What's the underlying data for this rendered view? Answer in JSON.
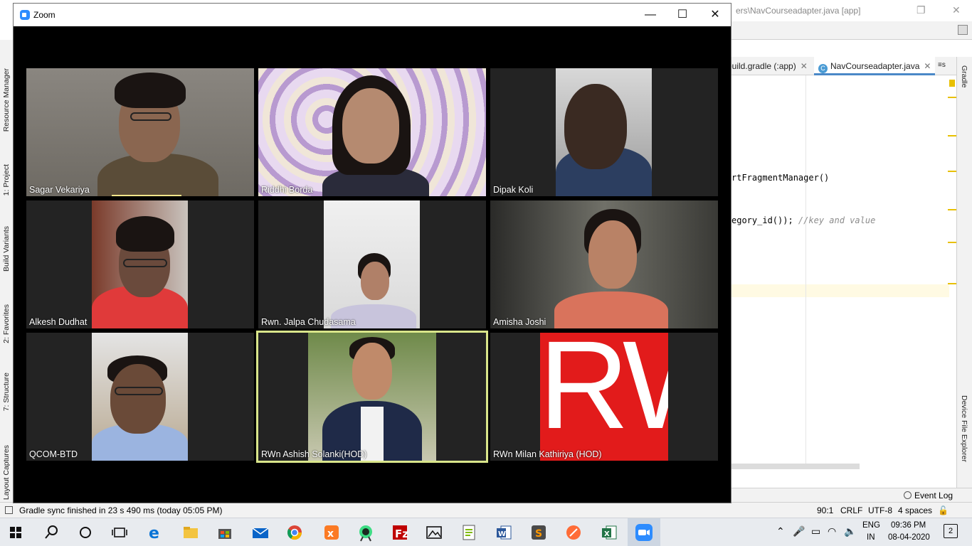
{
  "ide": {
    "title_fragment": "ers\\NavCourseadapter.java [app]",
    "tabs": [
      "build.gradle (:app)",
      "NavCourseadapter.java"
    ],
    "tab_more": "≡s",
    "code_lines": [
      "rtFragmentManager()",
      "egory_id()); ",
      "//key and value"
    ],
    "left_tool_tabs": [
      "Resource Manager",
      "1: Project",
      "Build Variants",
      "2: Favorites",
      "7: Structure",
      "Layout Captures"
    ],
    "right_tool_tabs": [
      "Gradle",
      "Device File Explorer"
    ],
    "event_log": "Event Log",
    "status_message": "Gradle sync finished in 23 s 490 ms (today 05:05 PM)",
    "status_right": {
      "position": "90:1",
      "line_sep": "CRLF",
      "encoding": "UTF-8",
      "indent": "4 spaces"
    }
  },
  "zoom": {
    "title": "Zoom",
    "participants": [
      {
        "name": "Sagar Vekariya"
      },
      {
        "name": "Riddhi Borda"
      },
      {
        "name": "Dipak Koli"
      },
      {
        "name": "Alkesh Dudhat"
      },
      {
        "name": "Rwn. Jalpa Chudasama"
      },
      {
        "name": "Amisha Joshi"
      },
      {
        "name": "QCOM-BTD"
      },
      {
        "name": "RWn Ashish Solanki(HOD)"
      },
      {
        "name": "RWn Milan Kathiriya (HOD)"
      }
    ],
    "rw_logo_text": "RW",
    "active_speaker_color": "#d9e58a"
  },
  "taskbar": {
    "apps": [
      "start-icon",
      "search-icon",
      "cortana-icon",
      "task-view-icon",
      "edge-icon",
      "file-explorer-icon",
      "store-icon",
      "mail-icon",
      "chrome-icon",
      "xampp-icon",
      "android-studio-icon",
      "filezilla-icon",
      "photos-icon",
      "notepadpp-icon",
      "word-icon",
      "sublime-icon",
      "postman-icon",
      "excel-icon",
      "zoom-icon"
    ],
    "language": "ENG",
    "region": "IN",
    "time": "09:36 PM",
    "date": "08-04-2020",
    "notifications": "2"
  }
}
